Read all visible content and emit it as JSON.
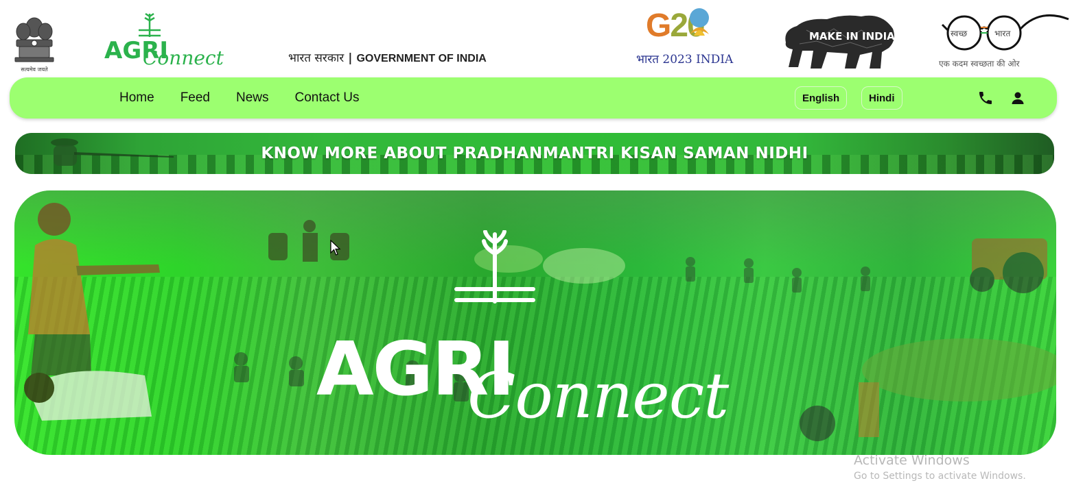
{
  "header": {
    "emblem_caption": "सत्यमेव जयते",
    "logo": {
      "agri": "AGRI",
      "connect": "Connect"
    },
    "government": {
      "hindi": "भारत सरकार",
      "separator": "|",
      "english": "GOVERNMENT OF INDIA"
    },
    "g20": {
      "mark_g": "G",
      "mark_20": "20",
      "subtitle": "भारत 2023 INDIA"
    },
    "make_in_india": "MAKE IN INDIA",
    "swachh": {
      "left_lens": "स्वच्छ",
      "right_lens": "भारत",
      "caption": "एक कदम स्वच्छता की ओर"
    }
  },
  "nav": {
    "links": [
      "Home",
      "Feed",
      "News",
      "Contact Us"
    ],
    "languages": {
      "english": "English",
      "hindi": "Hindi"
    },
    "icons": [
      "phone-icon",
      "user-icon"
    ]
  },
  "banner": {
    "text": "KNOW MORE ABOUT PRADHANMANTRI KISAN SAMAN NIDHI"
  },
  "hero": {
    "agri": "AGRI",
    "connect": "Connect"
  },
  "watermark": {
    "title": "Activate Windows",
    "subtitle": "Go to Settings to activate Windows."
  },
  "colors": {
    "nav_background": "#9cff70",
    "brand_green": "#2bb24c",
    "hero_green": "#35e32b",
    "banner_green": "#33b83b"
  }
}
